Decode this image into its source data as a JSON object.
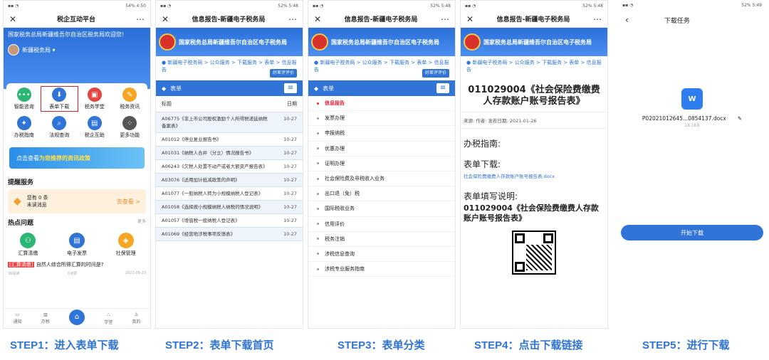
{
  "status": {
    "p1": "54% 4:50",
    "p2": "52% 5:48",
    "p3": "52% 5:48",
    "p4": "52% 5:48",
    "p5": "52% 5:49"
  },
  "phone1": {
    "title": "税企互动平台",
    "welcome": "国家税务总局新疆维吾尔自治区税务局欢迎您!",
    "user": "新疆税务局 ▾",
    "grid": [
      "智能咨询",
      "表单下载",
      "税务学堂",
      "税务资讯",
      "办税指南",
      "法规查询",
      "税企互助",
      "更多功能"
    ],
    "promo_prefix": "点击查看",
    "promo_bold": "为您推荐的资讯政策",
    "remind_title": "提醒服务",
    "remind_count": "您有 0 条",
    "remind_sub": "未读消息",
    "remind_go": "去查看 >",
    "hot_title": "热点问题",
    "hot_more": "更多",
    "hot": [
      "汇算清缴",
      "电子发票",
      "社保管理"
    ],
    "question_tag": "[汇算清缴]",
    "question": "自然人综合所得汇算的时间是?",
    "q_meta": [
      "36阅读",
      "0点赞",
      "2021-09-23"
    ],
    "tabs": [
      "通知",
      "办税",
      "学堂",
      "我的"
    ]
  },
  "phone2": {
    "title": "信息报告-新疆电子税务局",
    "gov": "国家税务总局新疆维吾尔自治区电子税务局",
    "crumb": "新疆电子税务局 > 公众服务 > 下载服务 > 表单 > 信息报告",
    "rate": "好差评评价",
    "formbar": "表单",
    "col_title": "标题",
    "col_date": "日期",
    "rows": [
      {
        "n": "A06775《非上市公司股权激励个人所得税递延纳税备案表》",
        "d": "10-27"
      },
      {
        "n": "A01012《停业复业报告书》",
        "d": "10-27"
      },
      {
        "n": "A01031《纳税人合并（分立）情况报告书》",
        "d": "10-27"
      },
      {
        "n": "A06243《欠税人处置不动产或者大额资产报告表》",
        "d": "10-27"
      },
      {
        "n": "A03076《适用加计抵减政策的声明》",
        "d": "10-27"
      },
      {
        "n": "A01077《一般纳税人转为小规模纳税人登记表》",
        "d": "10-27"
      },
      {
        "n": "A01058《选择按小规模纳税人纳税的情况说明》",
        "d": "10-27"
      },
      {
        "n": "A01057《增值税一般纳税人登记表》",
        "d": "10-27"
      },
      {
        "n": "A01069《经营地涉税事项反馈表》",
        "d": "10-27"
      }
    ]
  },
  "phone3": {
    "title": "信息报告-新疆电子税务局",
    "cats": [
      "信息报告",
      "发票办理",
      "申报纳税",
      "优惠办理",
      "证明办理",
      "社会保险费及非税收入业务",
      "出口退（免）税",
      "国际税收业务",
      "信用评价",
      "税务注销",
      "涉税信息查询",
      "涉税专业服务指南"
    ]
  },
  "phone4": {
    "title": "信息报告-新疆电子税务局",
    "doc_title": "011029004《社会保险费缴费人存款账户账号报告表》",
    "meta": "来源:   作者:   发布日期: 2021-01-26",
    "guide": "办税指南:",
    "download": "表单下载:",
    "link": "社会保险费缴费人存款账户账号报告表.docx",
    "fill": "表单填写说明:",
    "doc_sub": "011029004《社会保险费缴费人存款账户账号报告表》"
  },
  "phone5": {
    "title": "下载任务",
    "word": "W",
    "filename": "P02021012645...0854137.docx",
    "size": "18.1KB",
    "start": "开始下载"
  },
  "steps": [
    "STEP1：进入表单下载",
    "STEP2：表单下载首页",
    "STEP3：表单分类",
    "STEP4：点击下载链接",
    "STEP5：进行下载"
  ],
  "colors": {
    "accent": "#2f74d6",
    "highlight": "#d22222"
  }
}
